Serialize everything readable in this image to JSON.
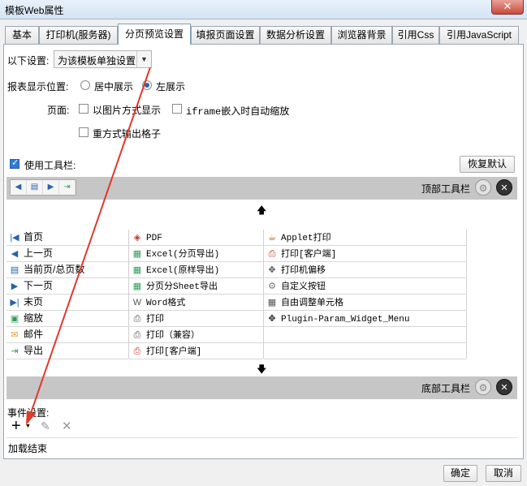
{
  "window": {
    "title": "模板Web属性",
    "close": "✕"
  },
  "tabs": [
    "基本",
    "打印机(服务器)",
    "分页预览设置",
    "填报页面设置",
    "数据分析设置",
    "浏览器背景",
    "引用Css",
    "引用JavaScript"
  ],
  "settings": {
    "scope_label": "以下设置:",
    "scope_value": "为该模板单独设置",
    "position_label": "报表显示位置:",
    "center_option": "居中展示",
    "left_option": "左展示",
    "page_label": "页面:",
    "image_option": "以图片方式显示",
    "iframe_option": "iframe嵌入时自动缩放",
    "heavy_option": "重方式输出格子",
    "use_toolbar": "使用工具栏:",
    "restore_default": "恢复默认"
  },
  "top_toolbar": {
    "label": "顶部工具栏",
    "icons": [
      "prev-icon",
      "page-number-icon",
      "next-icon",
      "export-icon"
    ]
  },
  "bottom_toolbar": {
    "label": "底部工具栏"
  },
  "buttons": {
    "col1": [
      {
        "icon": "first-icon",
        "glyph": "|◀",
        "color": "#2a62a8",
        "label": "首页"
      },
      {
        "icon": "prev-icon",
        "glyph": "◀",
        "color": "#2a62a8",
        "label": "上一页"
      },
      {
        "icon": "page-icon",
        "glyph": "▤",
        "color": "#2a62a8",
        "label": "当前页/总页数"
      },
      {
        "icon": "next-icon",
        "glyph": "▶",
        "color": "#2a62a8",
        "label": "下一页"
      },
      {
        "icon": "last-icon",
        "glyph": "▶|",
        "color": "#2a62a8",
        "label": "末页"
      },
      {
        "icon": "zoom-icon",
        "glyph": "▣",
        "color": "#2e9e5b",
        "label": "缩放"
      },
      {
        "icon": "mail-icon",
        "glyph": "✉",
        "color": "#e0a020",
        "label": "邮件"
      },
      {
        "icon": "export-icon",
        "glyph": "⇥",
        "color": "#2e9e5b",
        "label": "导出"
      }
    ],
    "col2": [
      {
        "icon": "pdf-icon",
        "glyph": "◈",
        "color": "#c0392b",
        "label": "PDF"
      },
      {
        "icon": "excel-icon",
        "glyph": "▦",
        "color": "#2e9e5b",
        "label": "Excel(分页导出)"
      },
      {
        "icon": "excel-icon",
        "glyph": "▦",
        "color": "#2e9e5b",
        "label": "Excel(原样导出)"
      },
      {
        "icon": "excel-icon",
        "glyph": "▦",
        "color": "#2e9e5b",
        "label": "分页分Sheet导出"
      },
      {
        "icon": "word-icon",
        "glyph": "W",
        "color": "#555555",
        "label": "Word格式"
      },
      {
        "icon": "printer-icon",
        "glyph": "⎙",
        "color": "#555555",
        "label": "打印"
      },
      {
        "icon": "printer-icon",
        "glyph": "⎙",
        "color": "#555555",
        "label": "打印（兼容）"
      },
      {
        "icon": "pdf-print-icon",
        "glyph": "⎙",
        "color": "#c0392b",
        "label": "打印[客户端]"
      }
    ],
    "col3": [
      {
        "icon": "applet-icon",
        "glyph": "☕",
        "color": "#b06a1a",
        "label": "Applet打印"
      },
      {
        "icon": "pdf-print-icon",
        "glyph": "⎙",
        "color": "#c0392b",
        "label": "打印[客户端]"
      },
      {
        "icon": "move-icon",
        "glyph": "✥",
        "color": "#555555",
        "label": "打印机偏移"
      },
      {
        "icon": "gear-icon",
        "glyph": "⚙",
        "color": "#777777",
        "label": "自定义按钮"
      },
      {
        "icon": "grid-icon",
        "glyph": "▦",
        "color": "#555555",
        "label": "自由调整单元格"
      },
      {
        "icon": "move-icon",
        "glyph": "✥",
        "color": "#222222",
        "label": "Plugin-Param_Widget_Menu"
      },
      {
        "icon": "",
        "glyph": "",
        "color": "#000",
        "label": ""
      },
      {
        "icon": "",
        "glyph": "",
        "color": "#000",
        "label": ""
      }
    ]
  },
  "events": {
    "label": "事件设置:",
    "items": [
      "加载结束"
    ]
  },
  "dialog": {
    "ok": "确定",
    "cancel": "取消"
  }
}
